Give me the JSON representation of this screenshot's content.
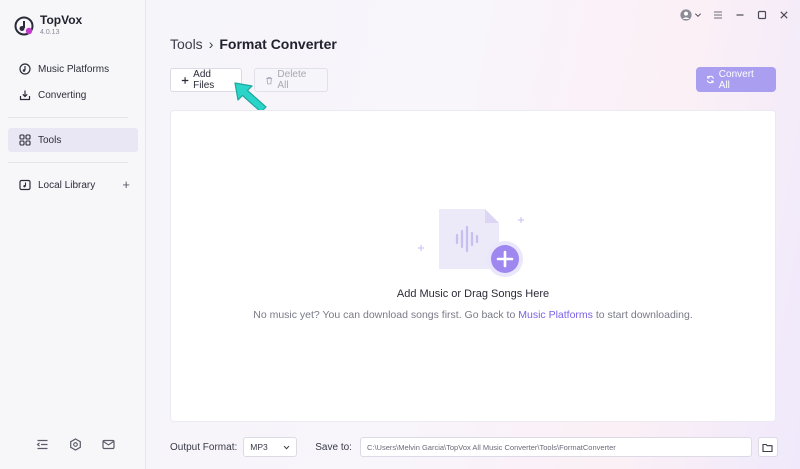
{
  "app": {
    "name": "TopVox",
    "version": "4.0.13"
  },
  "sidebar": {
    "items": [
      {
        "label": "Music Platforms",
        "icon": "music-platform-icon"
      },
      {
        "label": "Converting",
        "icon": "download-icon"
      },
      {
        "label": "Tools",
        "icon": "grid-icon",
        "active": true
      },
      {
        "label": "Local Library",
        "icon": "library-icon"
      }
    ],
    "library_add": "+",
    "bottom_icons": [
      "collapse-icon",
      "settings-icon",
      "mail-icon"
    ]
  },
  "header": {
    "breadcrumb_parent": "Tools",
    "breadcrumb_sep": "›",
    "breadcrumb_current": "Format Converter"
  },
  "toolbar": {
    "add_label": "Add Files",
    "delete_label": "Delete All",
    "convert_label": "Convert All"
  },
  "dropzone": {
    "title": "Add Music or Drag Songs Here",
    "sub_before": "No music yet? You can download songs first. Go back to ",
    "sub_link": "Music Platforms",
    "sub_after": " to start downloading."
  },
  "footer": {
    "format_label": "Output Format:",
    "format_value": "MP3",
    "save_label": "Save to:",
    "save_path": "C:\\Users\\Melvin Garcia\\TopVox All Music Converter\\Tools\\FormatConverter"
  },
  "colors": {
    "accent": "#a99ef0",
    "link": "#7b62e6",
    "arrow": "#2ad4c8"
  }
}
